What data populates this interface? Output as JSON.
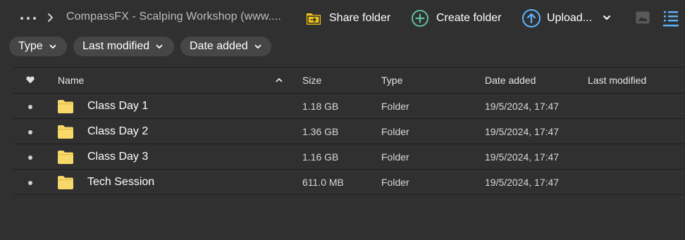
{
  "breadcrumb": {
    "more_icon": "more-horizontal-icon",
    "separator_icon": "chevron-right-icon",
    "current": "CompassFX - Scalping Workshop (www...."
  },
  "toolbar": {
    "share": {
      "label": "Share folder",
      "icon": "share-folder-icon",
      "color": "#f5c518"
    },
    "create": {
      "label": "Create folder",
      "icon": "plus-circle-icon",
      "color": "#5fc0a0"
    },
    "upload": {
      "label": "Upload...",
      "icon": "upload-arrow-icon",
      "color": "#5cb3ff"
    },
    "view_gallery_icon": "image-icon",
    "view_list_icon": "list-icon"
  },
  "filters": [
    {
      "label": "Type"
    },
    {
      "label": "Last modified"
    },
    {
      "label": "Date added"
    }
  ],
  "table": {
    "columns": {
      "favorite_icon": "heart-icon",
      "name": "Name",
      "size": "Size",
      "type": "Type",
      "date_added": "Date added",
      "last_modified": "Last modified"
    },
    "sort": {
      "column": "name",
      "direction": "ascending"
    },
    "rows": [
      {
        "name": "Class Day 1",
        "size": "1.18 GB",
        "type": "Folder",
        "date_added": "19/5/2024, 17:47",
        "last_modified": ""
      },
      {
        "name": "Class Day 2",
        "size": "1.36 GB",
        "type": "Folder",
        "date_added": "19/5/2024, 17:47",
        "last_modified": ""
      },
      {
        "name": "Class Day 3",
        "size": "1.16 GB",
        "type": "Folder",
        "date_added": "19/5/2024, 17:47",
        "last_modified": ""
      },
      {
        "name": "Tech Session",
        "size": "611.0 MB",
        "type": "Folder",
        "date_added": "19/5/2024, 17:47",
        "last_modified": ""
      }
    ]
  },
  "colors": {
    "background": "#303030",
    "chip": "#464646",
    "folder": "#f7d96b",
    "divider": "#1d1d1d"
  }
}
